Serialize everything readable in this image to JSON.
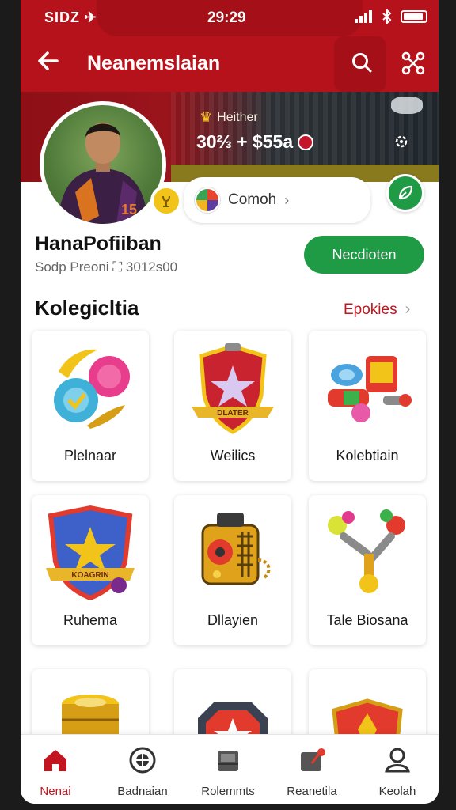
{
  "status_bar": {
    "left": "SIDZ ✈",
    "time": "29:29"
  },
  "app_bar": {
    "title": "Neanemslaian",
    "back_icon": "arrow-left-icon",
    "search_icon": "search-icon",
    "share_icon": "share-icon"
  },
  "profile": {
    "tier": "Heither",
    "coins": "30⅔ + $55a",
    "team": "Comoh",
    "name": "HanaPofiiban",
    "subtitle": "Sodp Preoni ⛶ 3012s00",
    "action_button": "Necdioten"
  },
  "collection": {
    "title": "Kolegicltia",
    "link": "Epokies",
    "items": [
      {
        "label": "Plelnaar"
      },
      {
        "label": "Weilics"
      },
      {
        "label": "Kolebtiain"
      },
      {
        "label": "Ruhema"
      },
      {
        "label": "Dllayien"
      },
      {
        "label": "Tale Biosana"
      },
      {
        "label": ""
      },
      {
        "label": ""
      },
      {
        "label": ""
      }
    ]
  },
  "bottom_nav": [
    {
      "label": "Nenai",
      "icon": "home-icon",
      "active": true
    },
    {
      "label": "Badnaian",
      "icon": "ball-icon",
      "active": false
    },
    {
      "label": "Rolemmts",
      "icon": "inbox-icon",
      "active": false
    },
    {
      "label": "Reanetila",
      "icon": "notification-icon",
      "active": false
    },
    {
      "label": "Keolah",
      "icon": "profile-icon",
      "active": false
    }
  ],
  "colors": {
    "brand_red": "#b5121b",
    "accent_green": "#1f9b45",
    "link_red": "#c2151f"
  }
}
